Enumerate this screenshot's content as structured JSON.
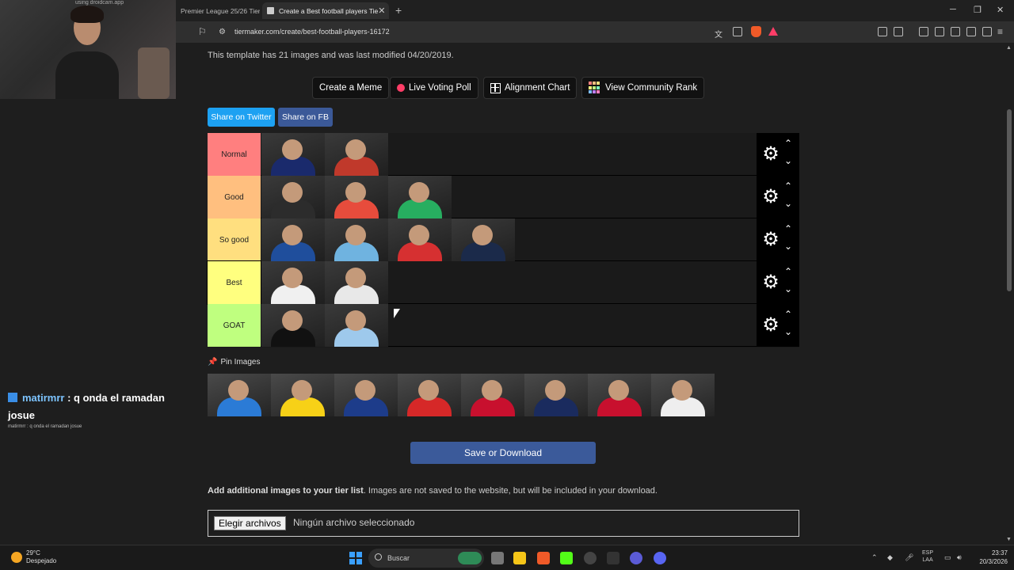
{
  "browser": {
    "tabs": [
      {
        "label": "Premier League 25/26 Tier L",
        "active": false
      },
      {
        "label": "Create a Best football players Tie",
        "active": true
      }
    ],
    "url": "tiermaker.com/create/best-football-players-16172"
  },
  "webcam": {
    "caption": "using droidcam.app"
  },
  "chat": {
    "user": "matirmrr",
    "message": ": q onda el ramadan josue",
    "mini": "matirmrr : q onda el ramadan josue"
  },
  "page": {
    "info": "This template has 21 images and was last modified 04/20/2019.",
    "buttons": {
      "meme": "Create a Meme",
      "poll": "Live Voting Poll",
      "alignment": "Alignment Chart",
      "community": "View Community Rank"
    },
    "share": {
      "twitter": "Share on Twitter",
      "fb": "Share on FB"
    },
    "tiers": [
      {
        "label": "Normal",
        "color": "#ff7f7f",
        "items": 2
      },
      {
        "label": "Good",
        "color": "#ffbf7f",
        "items": 3
      },
      {
        "label": "So good",
        "color": "#ffdf7f",
        "items": 4
      },
      {
        "label": "Best",
        "color": "#ffff7f",
        "items": 2
      },
      {
        "label": "GOAT",
        "color": "#bfff7f",
        "items": 2
      }
    ],
    "pin_label": "Pin Images",
    "pool_count": 8,
    "save_label": "Save or Download",
    "add_bold": "Add additional images to your tier list",
    "add_text": ". Images are not saved to the website, but will be included in your download.",
    "file_button": "Elegir archivos",
    "file_status": "Ningún archivo seleccionado"
  },
  "taskbar": {
    "temp": "29°C",
    "weather": "Despejado",
    "search": "Buscar",
    "lang1": "ESP",
    "lang2": "LAA",
    "time": "23:37",
    "date": "20/3/2026"
  }
}
